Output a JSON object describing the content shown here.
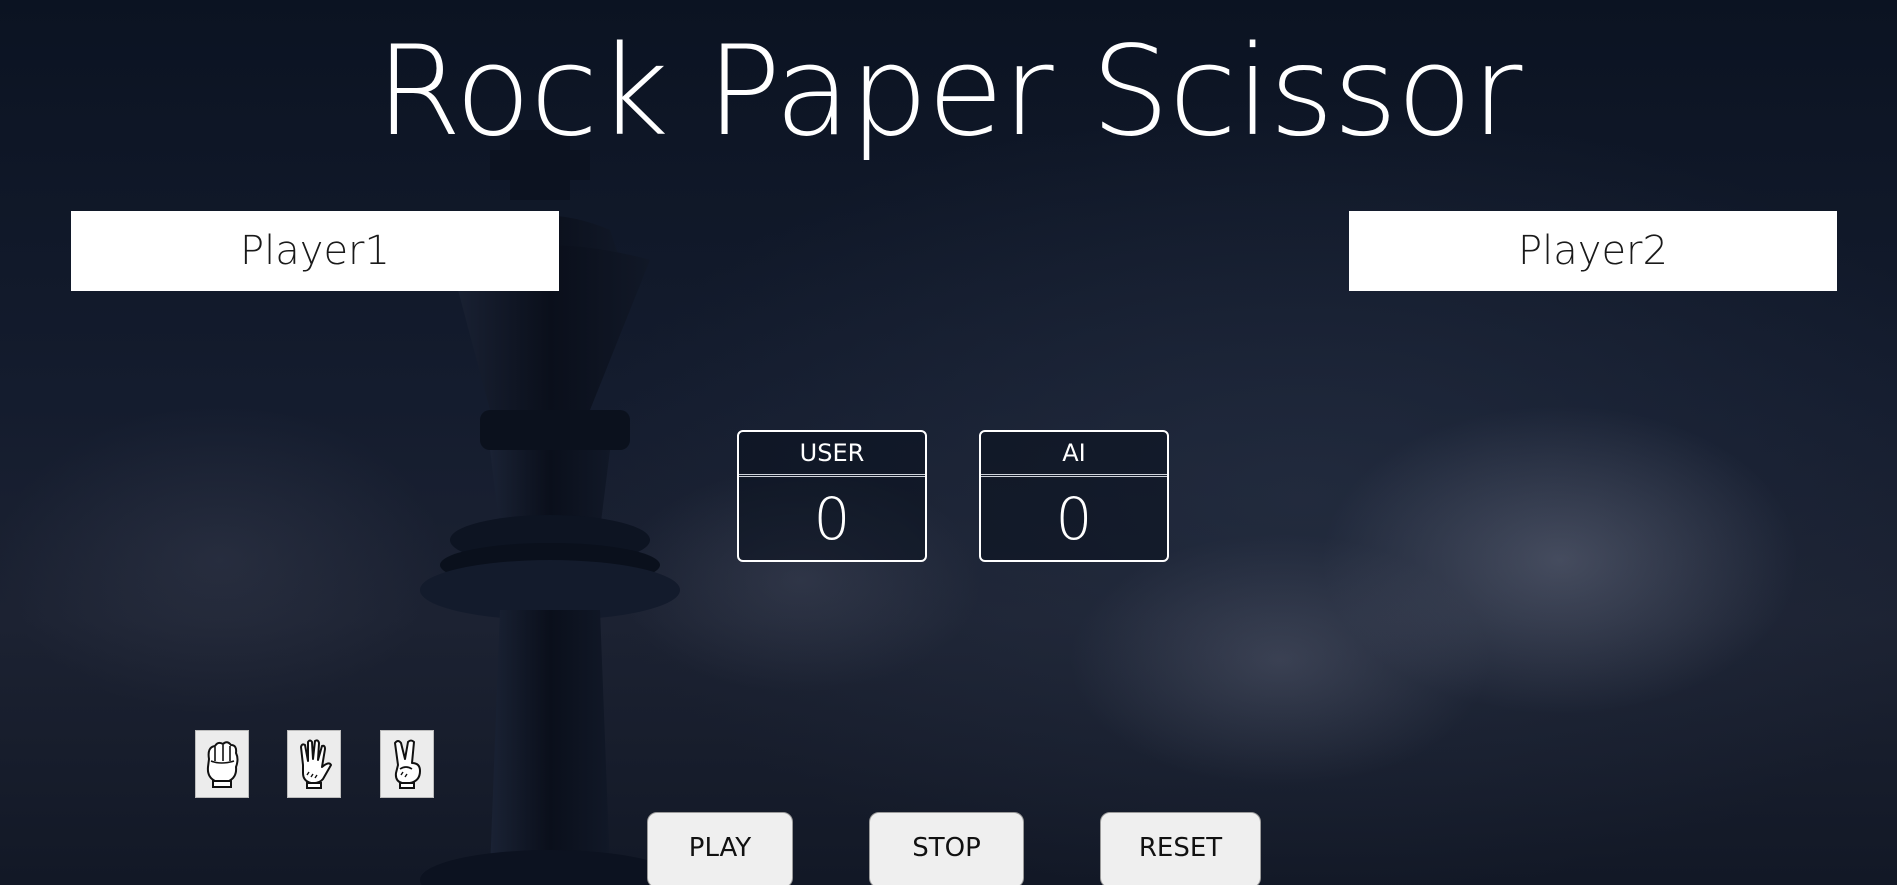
{
  "app": {
    "title": "Rock Paper Scissor"
  },
  "players": {
    "left_name": "Player1",
    "right_name": "Player2"
  },
  "scoreboard": {
    "user_label": "USER",
    "user_score": "0",
    "ai_label": "AI",
    "ai_score": "0"
  },
  "choices": [
    {
      "name": "rock",
      "icon": "rock-hand-icon"
    },
    {
      "name": "paper",
      "icon": "paper-hand-icon"
    },
    {
      "name": "scissor",
      "icon": "scissor-hand-icon"
    }
  ],
  "controls": {
    "play_label": "PLAY",
    "stop_label": "STOP",
    "reset_label": "RESET"
  },
  "colors": {
    "background": "#0e1626",
    "text": "#ffffff",
    "button_bg": "#efefef"
  }
}
